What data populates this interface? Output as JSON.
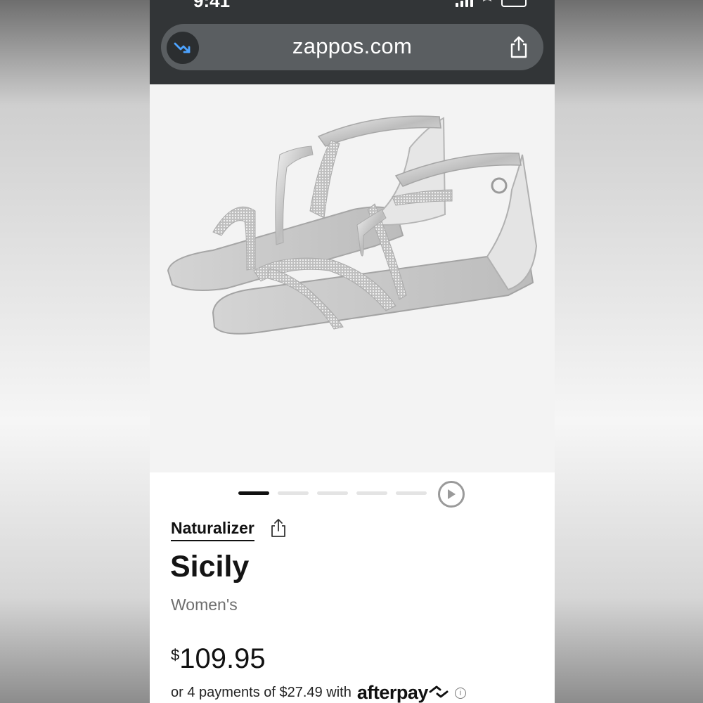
{
  "status_bar": {
    "time": "9:41"
  },
  "browser": {
    "url": "zappos.com"
  },
  "product": {
    "image_alt": "Silver rhinestone strappy flat sandals",
    "gallery": {
      "total": 5,
      "active_index": 0
    },
    "brand": "Naturalizer",
    "name": "Sicily",
    "gender": "Women's",
    "price_symbol": "$",
    "price_amount": "109.95",
    "installments_text": "or 4 payments of $27.49 with",
    "afterpay_label": "afterpay"
  },
  "colors": {
    "topbar": "#323537",
    "urlbar": "#5a5e61",
    "accent_blue": "#4da3ff",
    "text_primary": "#111111",
    "text_secondary": "#6e6e6e"
  },
  "icons": [
    "redirect-arrow-icon",
    "share-icon",
    "play-icon",
    "info-icon"
  ]
}
